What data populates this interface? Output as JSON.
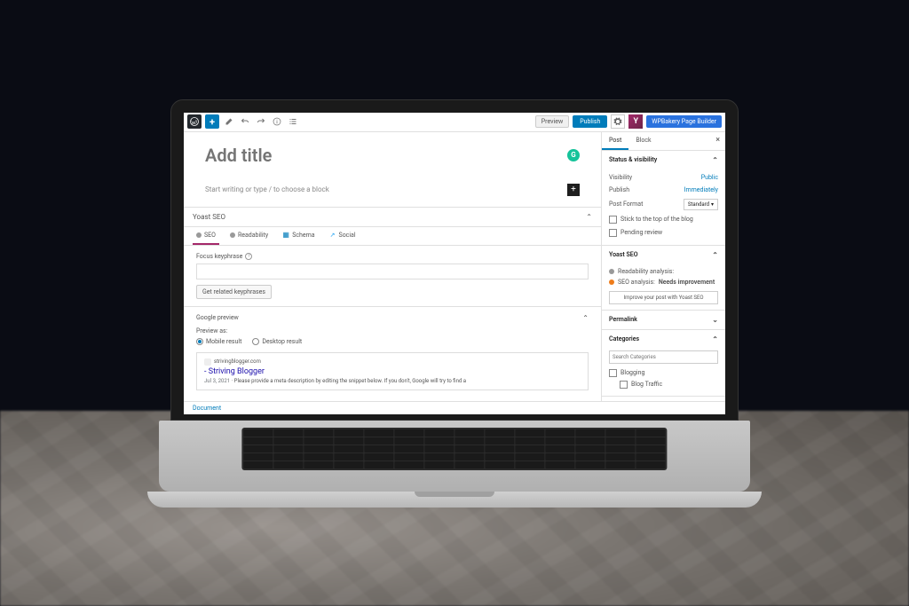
{
  "topbar": {
    "preview": "Preview",
    "publish": "Publish",
    "wpbakery": "WPBakery Page Builder"
  },
  "editor": {
    "title_placeholder": "Add title",
    "body_placeholder": "Start writing or type / to choose a block",
    "document_tab": "Document"
  },
  "yoast_metabox": {
    "title": "Yoast SEO",
    "tabs": {
      "seo": "SEO",
      "readability": "Readability",
      "schema": "Schema",
      "social": "Social"
    },
    "focus_keyphrase_label": "Focus keyphrase",
    "related_btn": "Get related keyphrases",
    "google_preview": "Google preview",
    "preview_as": "Preview as:",
    "mobile": "Mobile result",
    "desktop": "Desktop result",
    "serp": {
      "domain": "strivingblogger.com",
      "title": "- Striving Blogger",
      "date": "Jul 3, 2021",
      "desc": "Please provide a meta description by editing the snippet below. If you don't, Google will try to find a"
    }
  },
  "sidebar": {
    "tabs": {
      "post": "Post",
      "block": "Block"
    },
    "status": {
      "title": "Status & visibility",
      "visibility_label": "Visibility",
      "visibility_value": "Public",
      "publish_label": "Publish",
      "publish_value": "Immediately",
      "format_label": "Post Format",
      "format_value": "Standard",
      "stick": "Stick to the top of the blog",
      "pending": "Pending review"
    },
    "yoast": {
      "title": "Yoast SEO",
      "readability": "Readability analysis:",
      "seo": "SEO analysis:",
      "seo_status": "Needs improvement",
      "improve_btn": "Improve your post with Yoast SEO"
    },
    "permalink": {
      "title": "Permalink"
    },
    "categories": {
      "title": "Categories",
      "search_placeholder": "Search Categories",
      "items": [
        "Blogging",
        "Blog Traffic"
      ]
    }
  }
}
